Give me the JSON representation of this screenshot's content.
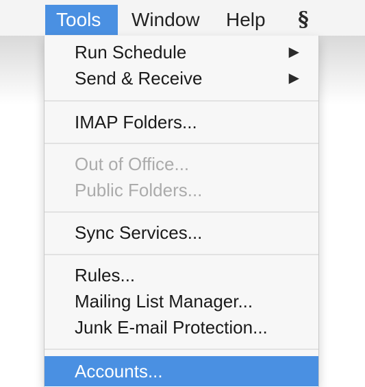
{
  "menubar": {
    "items": [
      {
        "label": "Tools",
        "active": true
      },
      {
        "label": "Window",
        "active": false
      },
      {
        "label": "Help",
        "active": false
      }
    ],
    "script_icon": "script-menu-icon"
  },
  "menu": {
    "groups": [
      [
        {
          "label": "Run Schedule",
          "submenu": true,
          "enabled": true
        },
        {
          "label": "Send & Receive",
          "submenu": true,
          "enabled": true
        }
      ],
      [
        {
          "label": "IMAP Folders...",
          "submenu": false,
          "enabled": true
        }
      ],
      [
        {
          "label": "Out of Office...",
          "submenu": false,
          "enabled": false
        },
        {
          "label": "Public Folders...",
          "submenu": false,
          "enabled": false
        }
      ],
      [
        {
          "label": "Sync Services...",
          "submenu": false,
          "enabled": true
        }
      ],
      [
        {
          "label": "Rules...",
          "submenu": false,
          "enabled": true
        },
        {
          "label": "Mailing List Manager...",
          "submenu": false,
          "enabled": true
        },
        {
          "label": "Junk E-mail Protection...",
          "submenu": false,
          "enabled": true
        }
      ],
      [
        {
          "label": "Accounts...",
          "submenu": false,
          "enabled": true,
          "highlighted": true
        }
      ]
    ],
    "submenu_arrow": "▶"
  },
  "colors": {
    "highlight": "#4a90e2",
    "disabled_text": "#ababab",
    "menu_background": "#f7f7f7"
  }
}
